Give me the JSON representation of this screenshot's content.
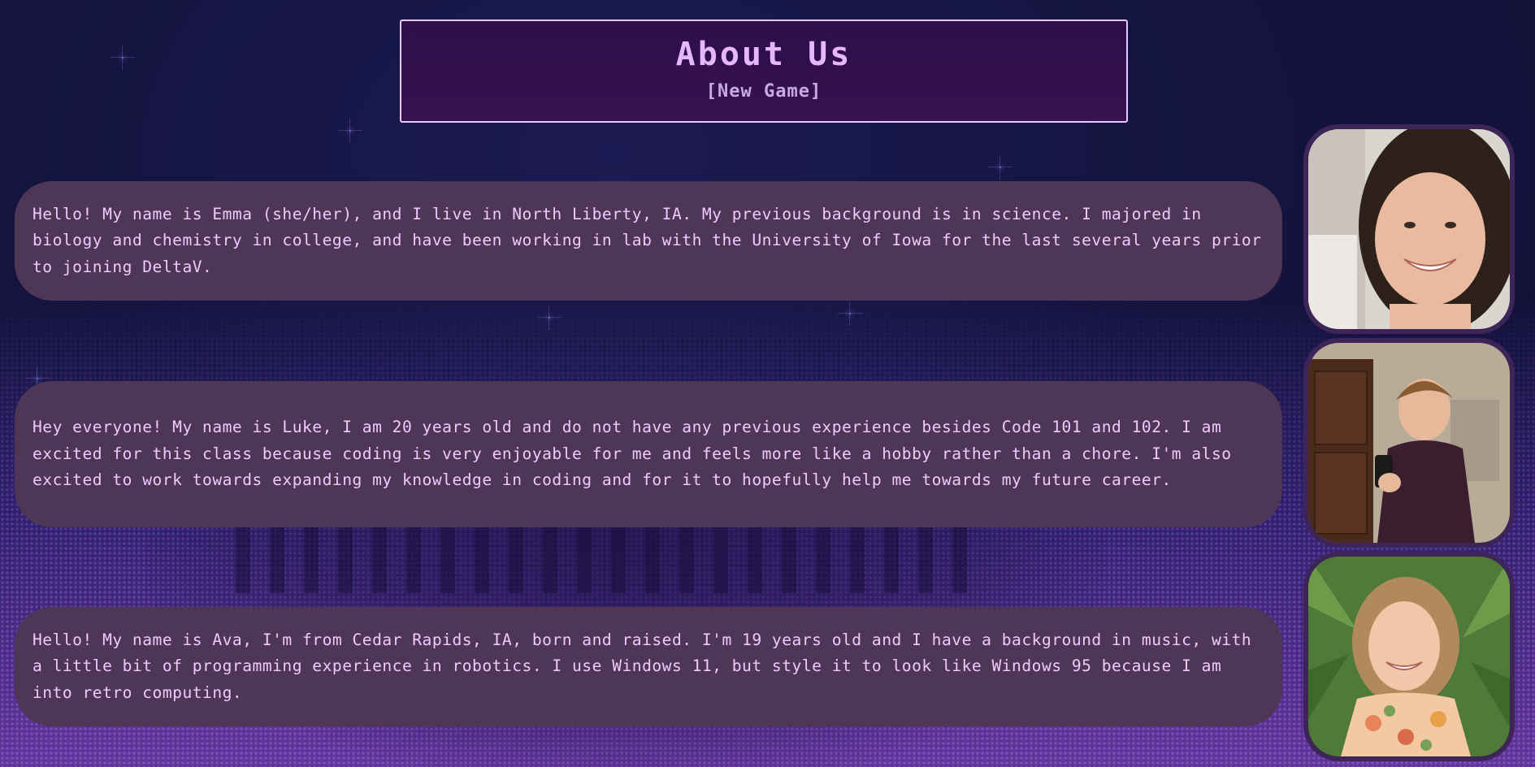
{
  "header": {
    "title": "About Us",
    "subtitle": "[New Game]"
  },
  "members": [
    {
      "name": "Emma",
      "bio": "Hello! My name is Emma (she/her), and I live in North Liberty, IA. My previous background is in science. I majored in biology and chemistry in college, and have been working in lab with the University of Iowa for the last several years prior to joining DeltaV."
    },
    {
      "name": "Luke",
      "bio": "Hey everyone! My name is Luke, I am 20 years old and do not have any previous experience besides Code 101 and 102. I am excited for this class because coding is very enjoyable for me and feels more like a hobby rather than a chore. I'm also excited to work towards expanding my knowledge in coding and for it to hopefully help me towards my future career."
    },
    {
      "name": "Ava",
      "bio": "Hello! My name is Ava, I'm from Cedar Rapids, IA, born and raised. I'm 19 years old and I have a background in music, with a little bit of programming experience in robotics. I use Windows 11, but style it to look like Windows 95 because I am into retro computing."
    }
  ],
  "colors": {
    "background": "#14143f",
    "card": "#4d3656",
    "card_text": "#f1c9ff",
    "title": "#e6b7ff",
    "header_border": "#e7c7ff",
    "header_bg": "#2d0f4a",
    "photo_border": "#3d2657"
  }
}
